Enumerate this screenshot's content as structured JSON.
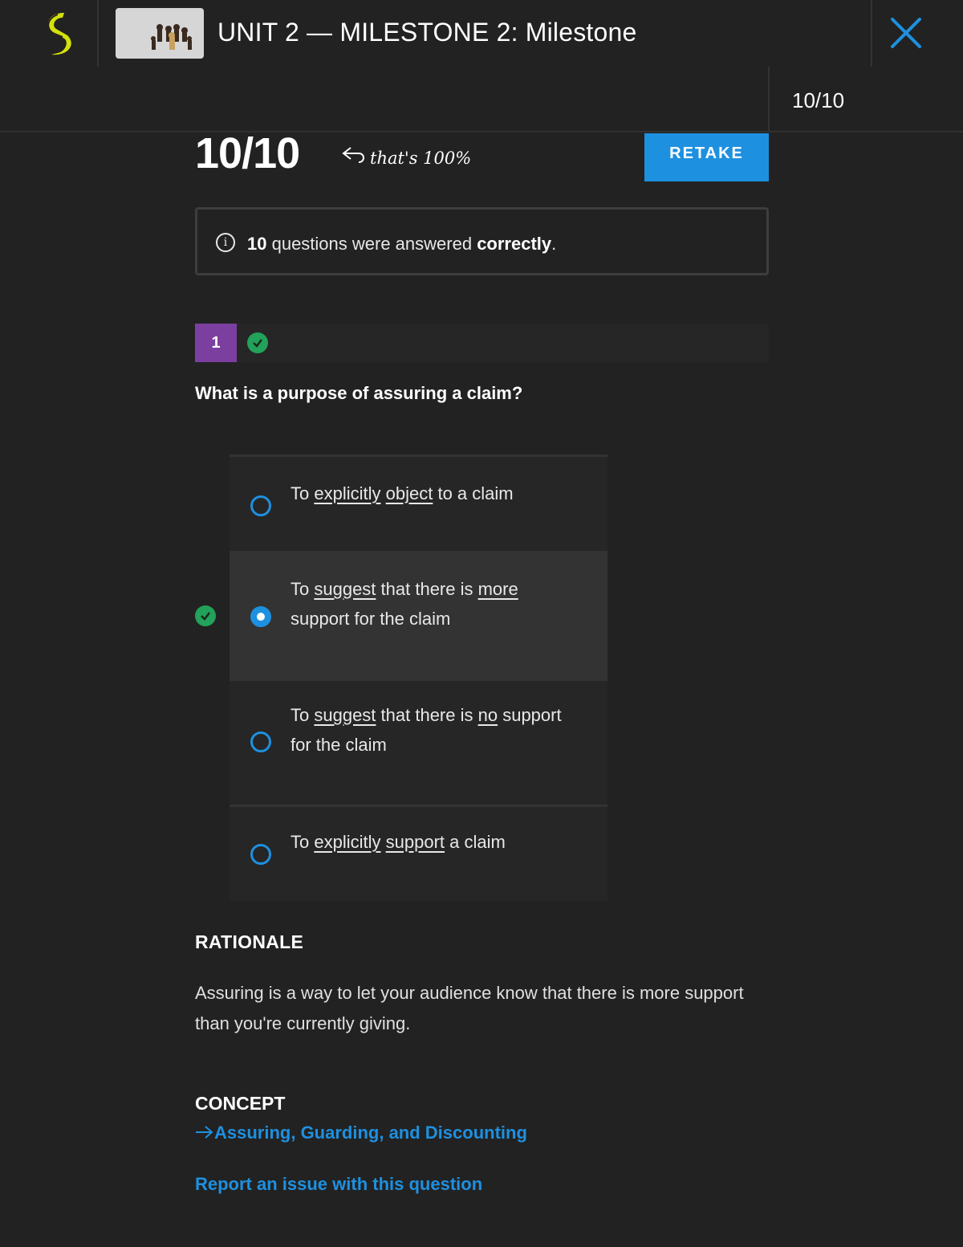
{
  "header": {
    "title": "UNIT 2 — MILESTONE 2: Milestone",
    "score": "10/10",
    "brand_color": "#d4e10a",
    "accent_color": "#1e90e0"
  },
  "result": {
    "score": "10/10",
    "note": "that's 100%",
    "retake_label": "RETAKE",
    "info": {
      "count": "10",
      "text_mid": " questions were answered ",
      "bold": "correctly",
      "end": "."
    }
  },
  "question": {
    "number": "1",
    "status": "correct",
    "text": "What is a purpose of assuring a claim?",
    "options": [
      {
        "parts": [
          "To ",
          "explicitly",
          " ",
          "object",
          " to a claim"
        ],
        "selected": false
      },
      {
        "parts": [
          "To ",
          "suggest",
          " that there is ",
          "more",
          " support for the claim"
        ],
        "selected": true
      },
      {
        "parts": [
          "To ",
          "suggest",
          " that there is ",
          "no",
          " support for the claim"
        ],
        "selected": false
      },
      {
        "parts": [
          "To ",
          "explicitly",
          " ",
          "support",
          " a claim"
        ],
        "selected": false
      }
    ]
  },
  "rationale": {
    "heading": "RATIONALE",
    "text": "Assuring is a way to let your audience know that there is more support than you're currently giving."
  },
  "concept": {
    "heading": "CONCEPT",
    "link_label": "Assuring, Guarding, and Discounting",
    "report_label": "Report an issue with this question"
  },
  "icons": {
    "logo": "sophia-logo-icon",
    "close": "close-icon",
    "info": "info-icon",
    "check": "check-circle-icon",
    "arrow": "arrow-right-icon"
  }
}
